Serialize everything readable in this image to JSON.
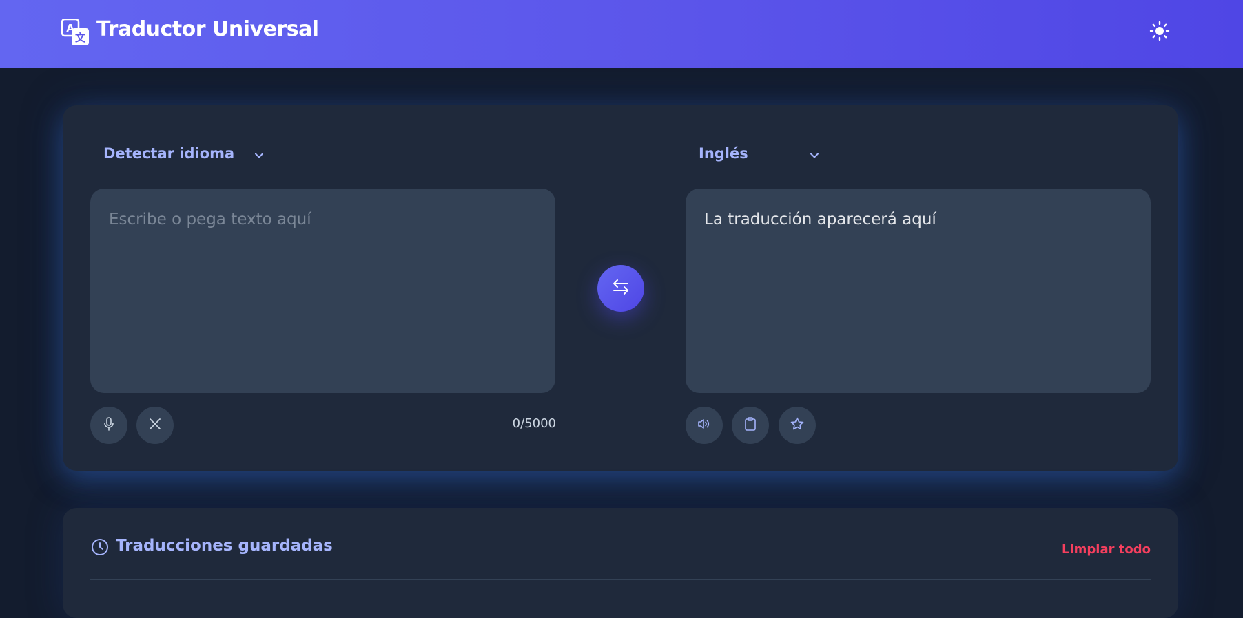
{
  "header": {
    "title": "Traductor Universal",
    "logo_icon": "translate-icon",
    "theme_icon": "sun-icon"
  },
  "translator": {
    "source_language": "Detectar idioma",
    "target_language": "Inglés",
    "source_placeholder": "Escribe o pega texto aquí",
    "output_placeholder": "La traducción aparecerá aquí",
    "char_count": "0/5000",
    "source_actions": [
      "microphone-icon",
      "close-icon"
    ],
    "target_actions": [
      "speaker-icon",
      "clipboard-icon",
      "star-icon"
    ],
    "swap_icon": "swap-arrows-icon"
  },
  "saved": {
    "title": "Traducciones guardadas",
    "clear_label": "Limpiar todo",
    "icon": "clock-icon"
  },
  "colors": {
    "accent": "#6366f1",
    "accent_dark": "#4f46e5",
    "background": "#131c2e",
    "card": "#1f293b",
    "input": "#334155",
    "label": "#a5b4fc",
    "danger": "#f43f5e"
  }
}
